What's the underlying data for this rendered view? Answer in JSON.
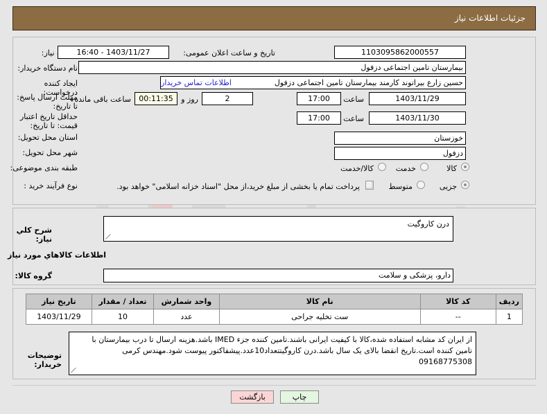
{
  "header": {
    "title": "جزئیات اطلاعات نیاز"
  },
  "watermark": {
    "text": "AriaTender.net"
  },
  "form": {
    "need_number": {
      "label": "شماره نیاز:",
      "value": "1103095862000557"
    },
    "announce_datetime": {
      "label": "تاریخ و ساعت اعلان عمومی:",
      "value": "1403/11/27 - 16:40"
    },
    "buyer_org": {
      "label": "نام دستگاه خریدار:",
      "value": "بیمارستان تامین اجتماعی دزفول"
    },
    "request_creator": {
      "label": "ایجاد کننده درخواست:",
      "value": "حسین زارع بیراتوند کارمند بیمارستان تامین اجتماعی دزفول"
    },
    "buyer_contact_link": "اطلاعات تماس خریدار",
    "response_deadline": {
      "label": "مهلت ارسال پاسخ: تا تاریخ:",
      "date": "1403/11/29",
      "hour_label": "ساعت",
      "hour": "17:00",
      "days": "2",
      "days_sep_label": "روز و",
      "countdown": "00:11:35",
      "countdown_label": "ساعت باقی مانده"
    },
    "price_validity": {
      "label": "حداقل تاریخ اعتبار قیمت: تا تاریخ:",
      "date": "1403/11/30",
      "hour_label": "ساعت",
      "hour": "17:00"
    },
    "delivery_province": {
      "label": "استان محل تحویل:",
      "value": "خوزستان"
    },
    "delivery_city": {
      "label": "شهر محل تحویل:",
      "value": "دزفول"
    },
    "subject_category": {
      "label": "طبقه بندی موضوعی:",
      "options": [
        "کالا",
        "خدمت",
        "کالا/خدمت"
      ],
      "selected_index": 0
    },
    "purchase_process": {
      "label": "نوع فرآیند خرید :",
      "options": [
        "جزیی",
        "متوسط"
      ],
      "selected_index": 0
    },
    "treasury_checkbox": {
      "label": "پرداخت تمام یا بخشی از مبلغ خرید،از محل \"اسناد خزانه اسلامی\" خواهد بود.",
      "checked": false
    }
  },
  "middle": {
    "need_summary": {
      "label": "شرح کلي نیاز:",
      "value": "درن کاروگیت"
    },
    "goods_section_title": "اطلاعات کالاهاي مورد نیاز",
    "goods_group": {
      "label": "گروه کالا:",
      "value": "دارو، پزشکی و سلامت"
    }
  },
  "table": {
    "columns": [
      "ردیف",
      "کد کالا",
      "نام کالا",
      "واحد شمارش",
      "تعداد / مقدار",
      "تاریخ نیاز"
    ],
    "rows": [
      [
        "1",
        "--",
        "ست تخلیه جراحی",
        "عدد",
        "10",
        "1403/11/29"
      ]
    ]
  },
  "buyer_notes": {
    "label": "توضیحات خریدار:",
    "value": "از ایران کد مشابه استفاده شده،کالا با کیفیت ایرانی باشند.تامین کننده جزء IMED باشد.هزینه ارسال تا درب بیمارستان با تامین کننده است.تاریخ انقضا بالای یک سال باشد.درن کاروگیتتعداد10عدد.پیشفاکتور پیوست شود.مهندس کرمی 09168775308"
  },
  "footer": {
    "back_button": "بازگشت",
    "print_button": "چاپ"
  }
}
